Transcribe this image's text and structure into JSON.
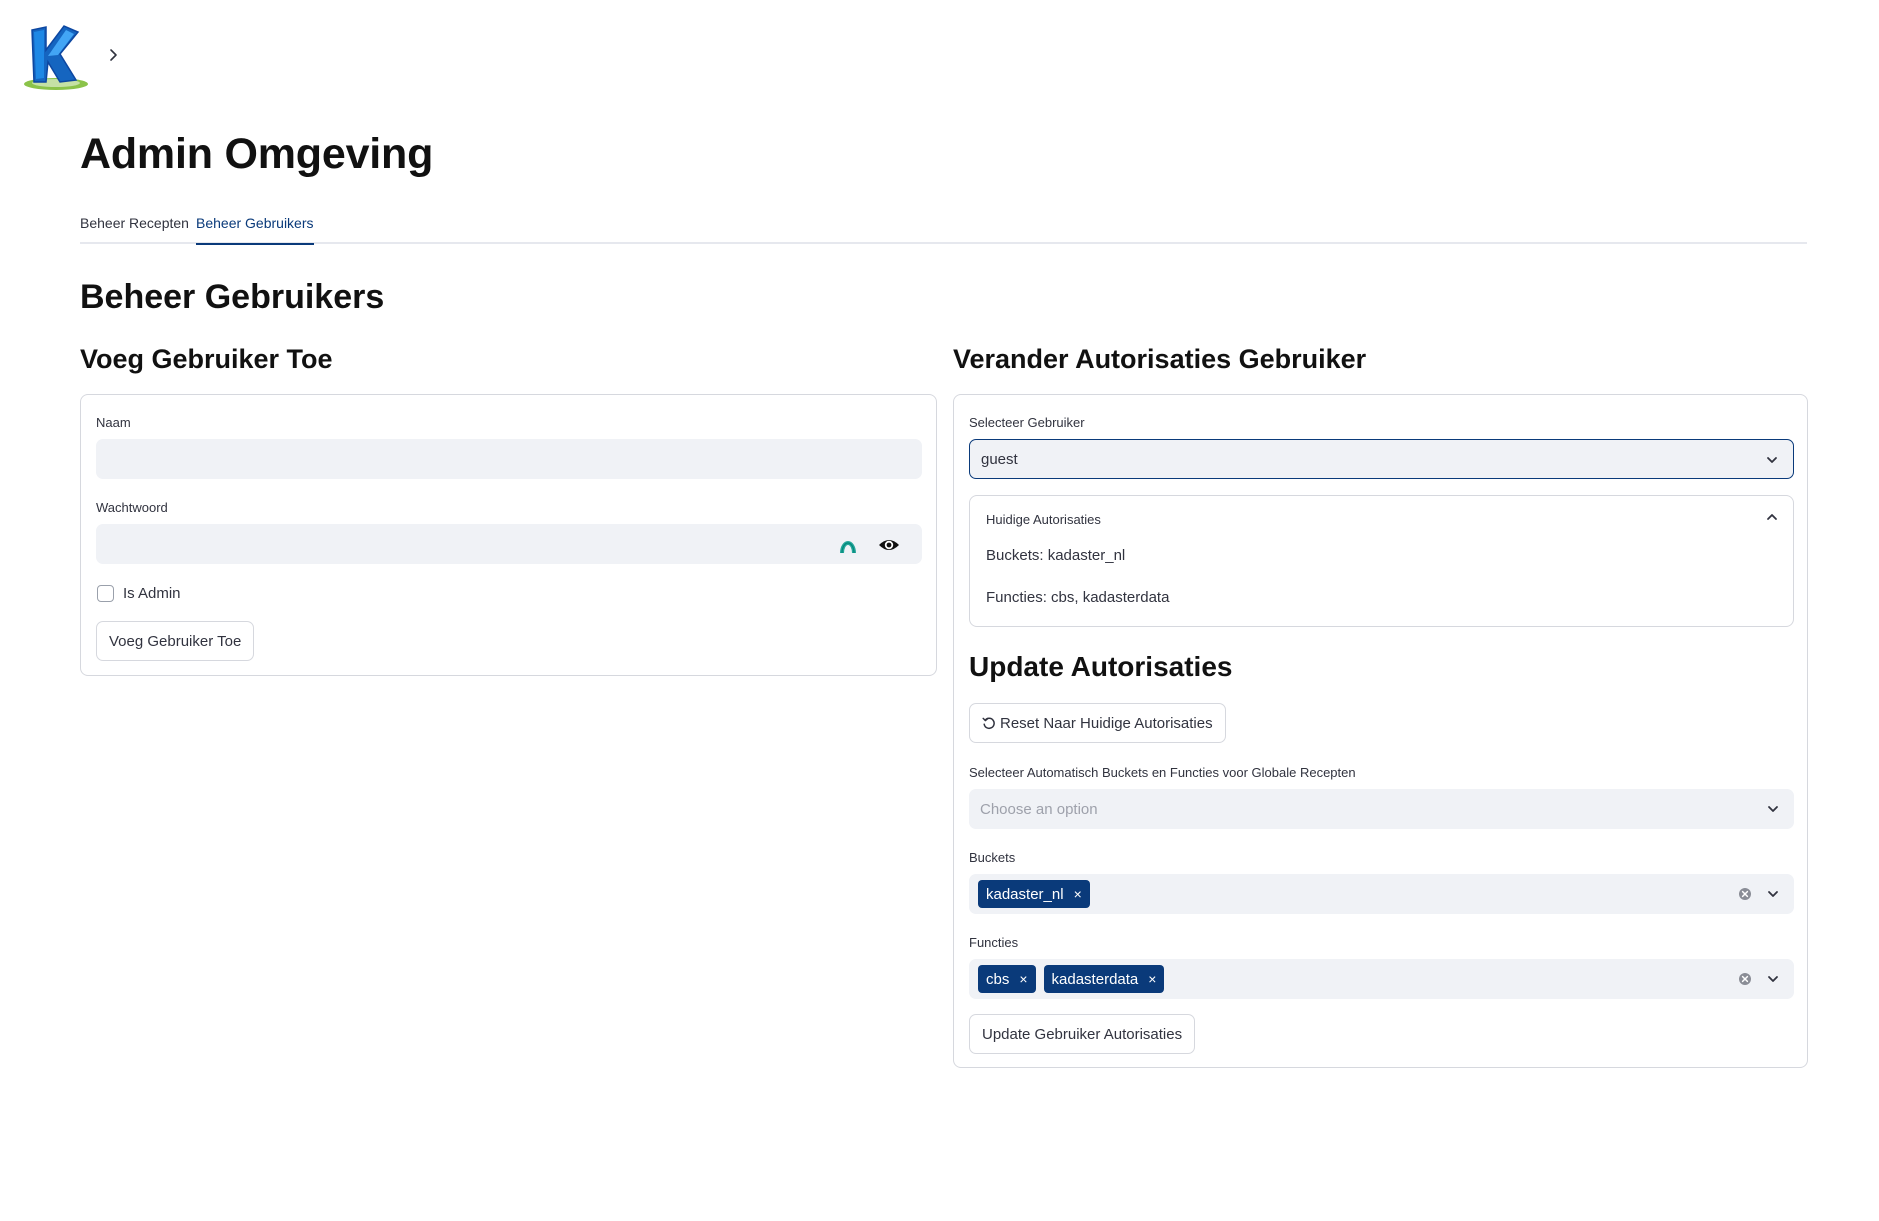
{
  "header": {
    "logo_icon": "kadaster-k-logo-icon",
    "chevron_icon": "chevron-right-icon"
  },
  "page": {
    "title": "Admin Omgeving"
  },
  "tabs": [
    {
      "label": "Beheer Recepten",
      "active": false
    },
    {
      "label": "Beheer Gebruikers",
      "active": true
    }
  ],
  "section": {
    "title": "Beheer Gebruikers"
  },
  "add_user": {
    "title": "Voeg Gebruiker Toe",
    "name_label": "Naam",
    "name_value": "",
    "password_label": "Wachtwoord",
    "password_value": "",
    "password_manager_icon": "password-manager-icon",
    "show_password_icon": "eye-icon",
    "is_admin_label": "Is Admin",
    "is_admin_checked": false,
    "submit_label": "Voeg Gebruiker Toe"
  },
  "change_auth": {
    "title": "Verander Autorisaties Gebruiker",
    "select_user_label": "Selecteer Gebruiker",
    "selected_user": "guest",
    "current": {
      "header": "Huidige Autorisaties",
      "buckets_line": "Buckets: kadaster_nl",
      "functions_line": "Functies: cbs, kadasterdata"
    },
    "update_title": "Update Autorisaties",
    "reset_label": "Reset Naar Huidige Autorisaties",
    "auto_select_label": "Selecteer Automatisch Buckets en Functies voor Globale Recepten",
    "auto_select_placeholder": "Choose an option",
    "buckets_label": "Buckets",
    "buckets": [
      "kadaster_nl"
    ],
    "functions_label": "Functies",
    "functions": [
      "cbs",
      "kadasterdata"
    ],
    "tag_remove_symbol": "×",
    "update_label": "Update Gebruiker Autorisaties"
  },
  "colors": {
    "accent": "#0a3a7a",
    "input_bg": "#f0f2f6",
    "border": "#d6d8de",
    "text": "#31333f"
  }
}
